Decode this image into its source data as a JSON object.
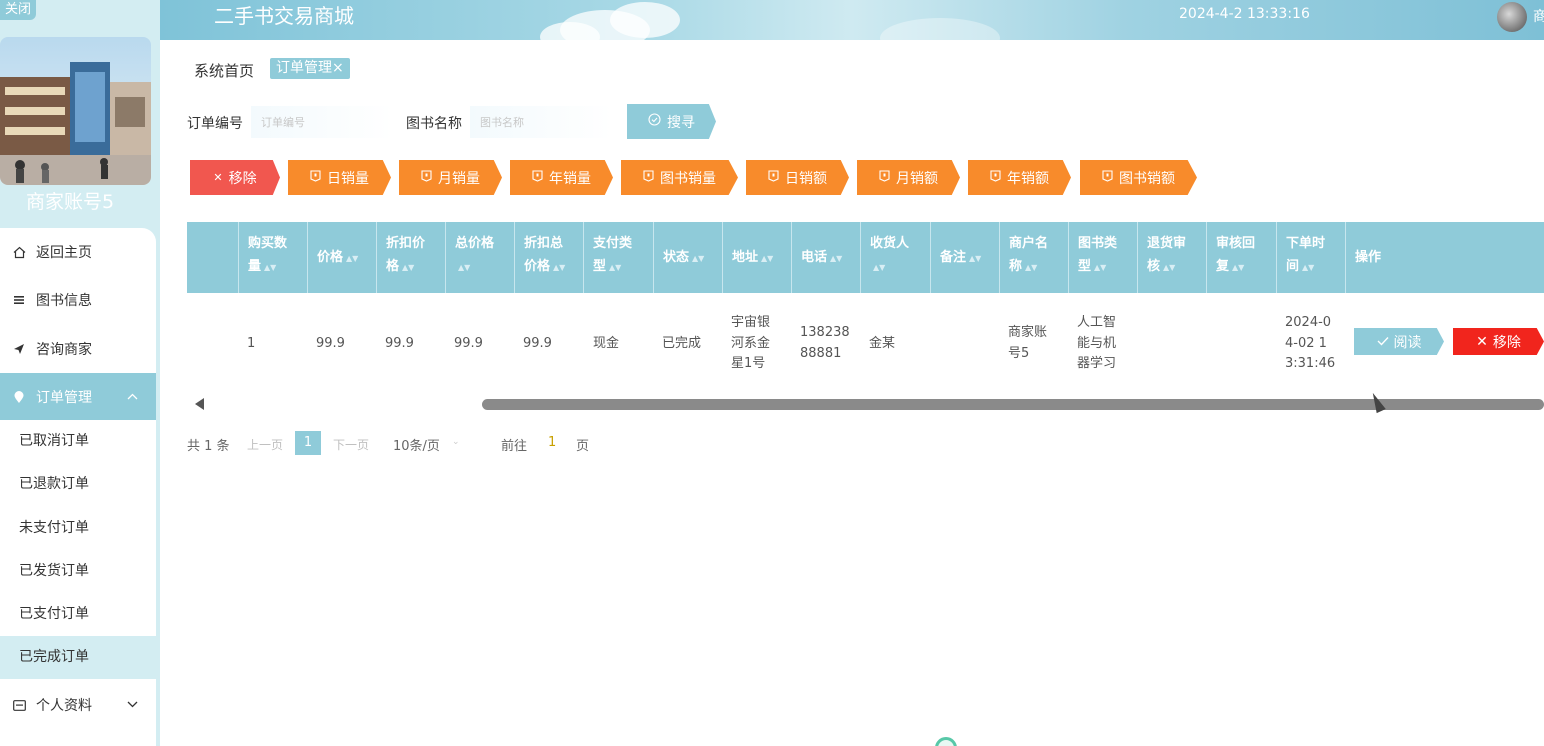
{
  "sidebar": {
    "close_label": "关闭",
    "merchant_name": "商家账号5",
    "menu": [
      {
        "label": "返回主页",
        "icon": "home-icon"
      },
      {
        "label": "图书信息",
        "icon": "list-icon"
      },
      {
        "label": "咨询商家",
        "icon": "send-icon"
      },
      {
        "label": "订单管理",
        "icon": "location-pin-icon",
        "expanded": true
      }
    ],
    "sub_items": [
      "已取消订单",
      "已退款订单",
      "未支付订单",
      "已发货订单",
      "已支付订单",
      "已完成订单"
    ],
    "active_sub_item": "已完成订单",
    "profile": {
      "label": "个人资料",
      "icon": "id-card-icon"
    }
  },
  "header": {
    "title": "二手书交易商城",
    "datetime": "2024-4-2 13:33:16",
    "user_name": "商"
  },
  "breadcrumb": {
    "home": "系统首页",
    "current_tag": "订单管理×"
  },
  "search": {
    "order_no_label": "订单编号",
    "order_no_placeholder": "订单编号",
    "book_name_label": "图书名称",
    "book_name_placeholder": "图书名称",
    "button_label": "搜寻"
  },
  "toolbar": [
    {
      "label": "移除",
      "color": "#f1574f"
    },
    {
      "label": "日销量",
      "color": "#f88b2b"
    },
    {
      "label": "月销量",
      "color": "#f88b2b"
    },
    {
      "label": "年销量",
      "color": "#f88b2b"
    },
    {
      "label": "图书销量",
      "color": "#f88b2b"
    },
    {
      "label": "日销额",
      "color": "#f88b2b"
    },
    {
      "label": "月销额",
      "color": "#f88b2b"
    },
    {
      "label": "年销额",
      "color": "#f88b2b"
    },
    {
      "label": "图书销额",
      "color": "#f88b2b"
    }
  ],
  "table": {
    "columns": [
      {
        "l1": "购买数",
        "l2": "量"
      },
      {
        "l1": "价格",
        "l2": ""
      },
      {
        "l1": "折扣价",
        "l2": "格"
      },
      {
        "l1": "总价格",
        "l2": ""
      },
      {
        "l1": "折扣总",
        "l2": "价格"
      },
      {
        "l1": "支付类",
        "l2": "型"
      },
      {
        "l1": "状态",
        "l2": ""
      },
      {
        "l1": "地址",
        "l2": ""
      },
      {
        "l1": "电话",
        "l2": ""
      },
      {
        "l1": "收货人",
        "l2": ""
      },
      {
        "l1": "备注",
        "l2": ""
      },
      {
        "l1": "商户名",
        "l2": "称"
      },
      {
        "l1": "图书类",
        "l2": "型"
      },
      {
        "l1": "退货审",
        "l2": "核"
      },
      {
        "l1": "审核回",
        "l2": "复"
      },
      {
        "l1": "下单时",
        "l2": "间"
      },
      {
        "l1": "操作",
        "l2": ""
      }
    ],
    "rows": [
      {
        "quantity": "1",
        "price": "99.9",
        "discount_price": "99.9",
        "total_price": "99.9",
        "discount_total": "99.9",
        "payment_type": "现金",
        "status": "已完成",
        "address": [
          "宇宙银",
          "河系金",
          "星1号"
        ],
        "phone": [
          "138238",
          "88881"
        ],
        "receiver": "金某",
        "remark": "",
        "merchant": [
          "商家账",
          "号5"
        ],
        "book_type": [
          "人工智",
          "能与机",
          "器学习"
        ],
        "return_review": "",
        "review_reply": "",
        "order_time": [
          "2024-0",
          "4-02 1",
          "3:31:46"
        ],
        "read_label": "阅读",
        "remove_label": "移除"
      }
    ]
  },
  "pagination": {
    "total": "共 1 条",
    "prev": "上一页",
    "current_page": "1",
    "next": "下一页",
    "page_size": "10条/页",
    "goto_label": "前往",
    "goto_value": "1",
    "page_unit": "页"
  },
  "colors": {
    "accent": "#8fcbd9",
    "danger": "#f1574f",
    "warning": "#f88b2b",
    "sidebar_bg": "#d3edf2"
  }
}
